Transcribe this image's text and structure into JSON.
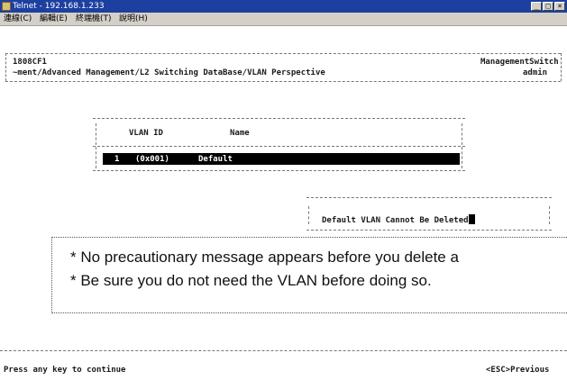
{
  "window": {
    "title": "Telnet - 192.168.1.233",
    "minimize": "_",
    "maximize": "□",
    "close": "×"
  },
  "menu": [
    "連線(C)",
    "編輯(E)",
    "終端機(T)",
    "說明(H)"
  ],
  "header": {
    "device": "1808CF1",
    "path": "~ment/Advanced Management/L2 Switching DataBase/VLAN Perspective",
    "product": "ManagementSwitch",
    "user": "admin"
  },
  "vlan_table": {
    "columns": [
      "VLAN ID",
      "Name"
    ],
    "rows": [
      {
        "id": "1",
        "hex": "(0x001)",
        "name": "Default"
      }
    ]
  },
  "message": "Default VLAN Cannot Be Deleted",
  "callout": {
    "line1": "* No precautionary message appears before you delete a",
    "line2": "* Be sure you do not need the VLAN before doing so."
  },
  "footer": {
    "left": "Press any key to continue",
    "right": "<ESC>Previous"
  }
}
